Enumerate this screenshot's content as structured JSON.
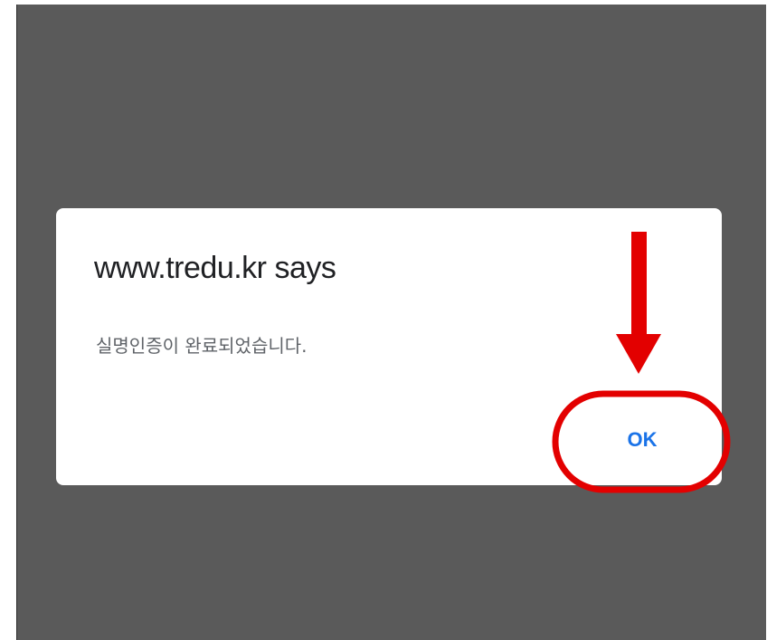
{
  "dialog": {
    "title": "www.tredu.kr says",
    "message": "실명인증이 완료되었습니다.",
    "ok_label": "OK"
  },
  "annotation": {
    "highlight_color": "#e30000",
    "pointer_icon": "arrow-down-icon"
  },
  "colors": {
    "backdrop": "#5a5a5a",
    "dialog_bg": "#ffffff",
    "button_text": "#1a73e8"
  }
}
